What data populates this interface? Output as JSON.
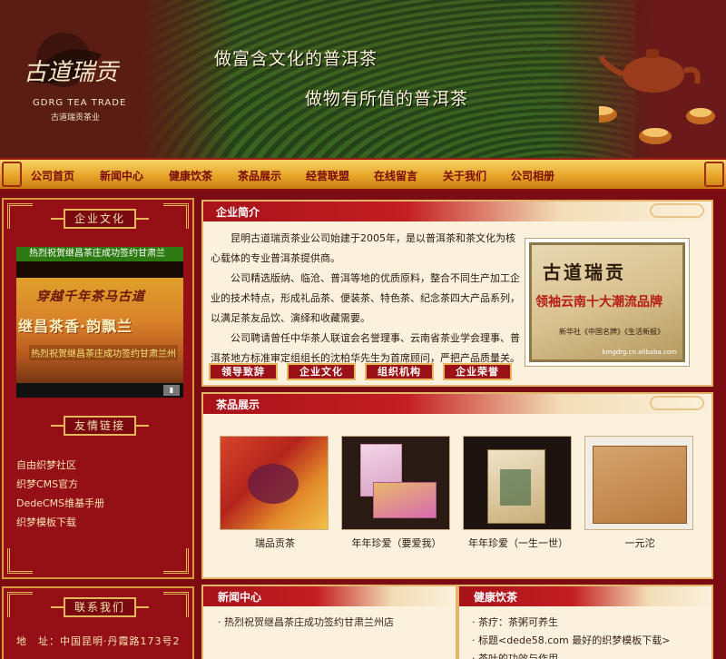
{
  "header": {
    "logo_en": "GDRG TEA TRADE",
    "logo_cn": "古道瑞贡茶业",
    "logo_mark": "古道瑞贡",
    "slogan1": "做富含文化的普洱茶",
    "slogan2": "做物有所值的普洱茶"
  },
  "nav": {
    "items": [
      "公司首页",
      "新闻中心",
      "健康饮茶",
      "茶品展示",
      "经营联盟",
      "在线留言",
      "关于我们",
      "公司相册"
    ]
  },
  "sidebar": {
    "culture_title": "企业文化",
    "banner_caption": "热烈祝贺继昌茶庄成功签约甘肃兰",
    "banner_line1": "穿越千年茶马古道",
    "banner_line2": "继昌茶香·韵飘兰",
    "banner_line3": "热烈祝贺继昌茶庄成功签约甘肃兰州",
    "links_title": "友情链接",
    "links": [
      "自由织梦社区",
      "织梦CMS官方",
      "DedeCMS维基手册",
      "织梦模板下载"
    ],
    "contact_title": "联系我们",
    "address": "地　址：中国昆明·丹霞路173号2"
  },
  "intro": {
    "title": "企业简介",
    "p1": "昆明古道瑞贡茶业公司始建于2005年，是以普洱茶和茶文化为核心载体的专业普洱茶提供商。",
    "p2": "公司精选版纳、临沧、普洱等地的优质原料，整合不同生产加工企业的技术特点，形成礼品茶、便装茶、特色茶、纪念茶四大产品系列，以满足茶友品饮、演绎和收藏需要。",
    "p3": "公司聘请曾任中华茶人联谊会名誉理事、云南省茶业学会理事、普洱茶地方标准审定组组长的沈柏华先生为首席顾问，严把产品质量关。",
    "plaque_line1": "古道瑞贡",
    "plaque_line2": "领袖云南十大潮流品牌",
    "plaque_line3": "新华社《中国名牌》《生活新报》",
    "plaque_watermark": "kmgdrg.cn.alibaba.com",
    "buttons": [
      "领导致辞",
      "企业文化",
      "组织机构",
      "企业荣誉"
    ]
  },
  "products": {
    "title": "茶品展示",
    "items": [
      {
        "name": "瑞品贡茶"
      },
      {
        "name": "年年珍爱（要爱我）"
      },
      {
        "name": "年年珍爱（一生一世）"
      },
      {
        "name": "一元沱"
      }
    ]
  },
  "news": {
    "title": "新闻中心",
    "items": [
      "· 热烈祝贺继昌茶庄成功签约甘肃兰州店"
    ]
  },
  "health": {
    "title": "健康饮茶",
    "items": [
      "· 茶疗：茶粥可养生",
      "· 标题<dede58.com 最好的织梦模板下载>",
      "· 茶叶的功效与作用"
    ]
  }
}
